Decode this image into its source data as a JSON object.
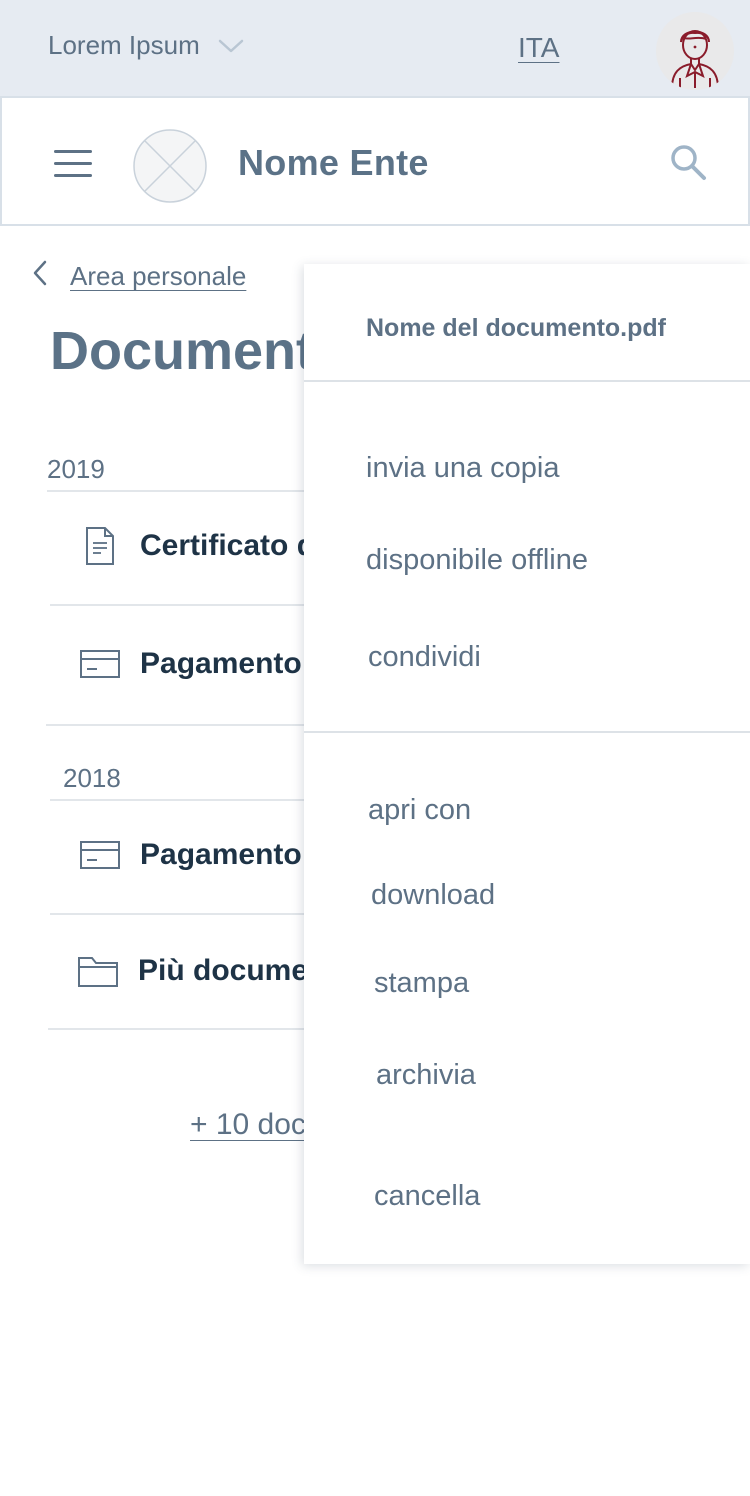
{
  "topbar": {
    "site_selector_label": "Lorem Ipsum",
    "language": "ITA"
  },
  "header": {
    "brand_name": "Nome Ente"
  },
  "breadcrumb": {
    "link_label": "Area personale"
  },
  "page": {
    "title": "Documenti",
    "groups": [
      {
        "year": "2019",
        "items": [
          {
            "icon": "document-icon",
            "title": "Certificato d"
          },
          {
            "icon": "credit-card-icon",
            "title": "Pagamento"
          }
        ]
      },
      {
        "year": "2018",
        "items": [
          {
            "icon": "credit-card-icon",
            "title": "Pagamento"
          },
          {
            "icon": "folder-icon",
            "title": "Più documen"
          }
        ]
      }
    ],
    "more_link": "+ 10 doc"
  },
  "menu": {
    "title": "Nome del documento.pdf",
    "items": [
      {
        "label": "invia una copia"
      },
      {
        "label": "disponibile offline"
      },
      {
        "label": "condividi"
      },
      {
        "label": "apri con"
      },
      {
        "label": "download"
      },
      {
        "label": "stampa"
      },
      {
        "label": "archivia"
      },
      {
        "label": "cancella"
      }
    ]
  },
  "colors": {
    "topbar_bg": "#e6ebf2",
    "primary_text": "#5d7185",
    "dark_text": "#1e3346",
    "avatar_accent": "#8a1c2b"
  }
}
